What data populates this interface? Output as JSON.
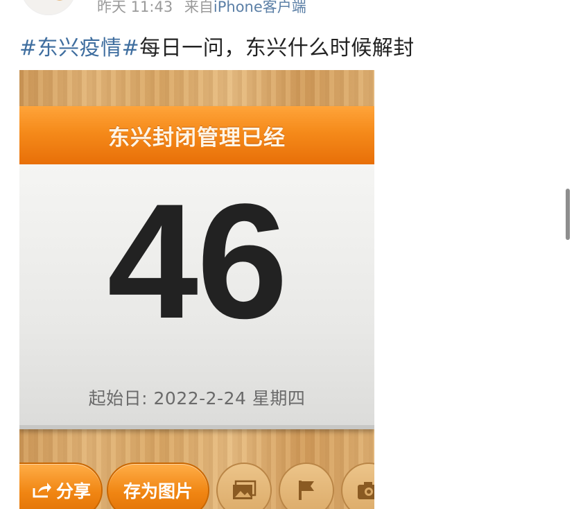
{
  "post": {
    "time": "昨天 11:43",
    "source_prefix": "来自",
    "source": "iPhone客户端",
    "hashtag": "#东兴疫情#",
    "text": "每日一问，东兴什么时候解封"
  },
  "image": {
    "header": "东兴封闭管理已经",
    "count": "46",
    "start_label": "起始日: 2022-2-24 星期四",
    "buttons": {
      "share": "分享",
      "save": "存为图片"
    },
    "icons": [
      "share-arrow-icon",
      "photo-icon",
      "flag-icon",
      "camera-icon"
    ]
  },
  "colors": {
    "orange": "#f58a1a",
    "link": "#3f6e9f",
    "wood": "#dfb174"
  }
}
